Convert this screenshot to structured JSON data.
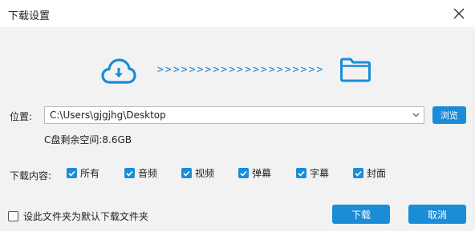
{
  "window": {
    "title": "下载设置"
  },
  "location": {
    "label": "位置:",
    "path": "C:\\Users\\gjgjhg\\Desktop",
    "browse_label": "浏览",
    "space_info": "C盘剩余空间:8.6GB"
  },
  "hero": {
    "arrows": ">>>>>>>>>>>>>>>>>>>>>"
  },
  "download_content": {
    "label": "下载内容:",
    "options": [
      {
        "label": "所有",
        "checked": true
      },
      {
        "label": "音频",
        "checked": true
      },
      {
        "label": "视频",
        "checked": true
      },
      {
        "label": "弹幕",
        "checked": true
      },
      {
        "label": "字幕",
        "checked": true
      },
      {
        "label": "封面",
        "checked": true
      }
    ]
  },
  "footer": {
    "default_folder_label": "设此文件夹为默认下载文件夹",
    "default_folder_checked": false,
    "download_label": "下载",
    "cancel_label": "取消"
  },
  "colors": {
    "accent": "#1a8cd8",
    "background": "#f2f2f2"
  }
}
